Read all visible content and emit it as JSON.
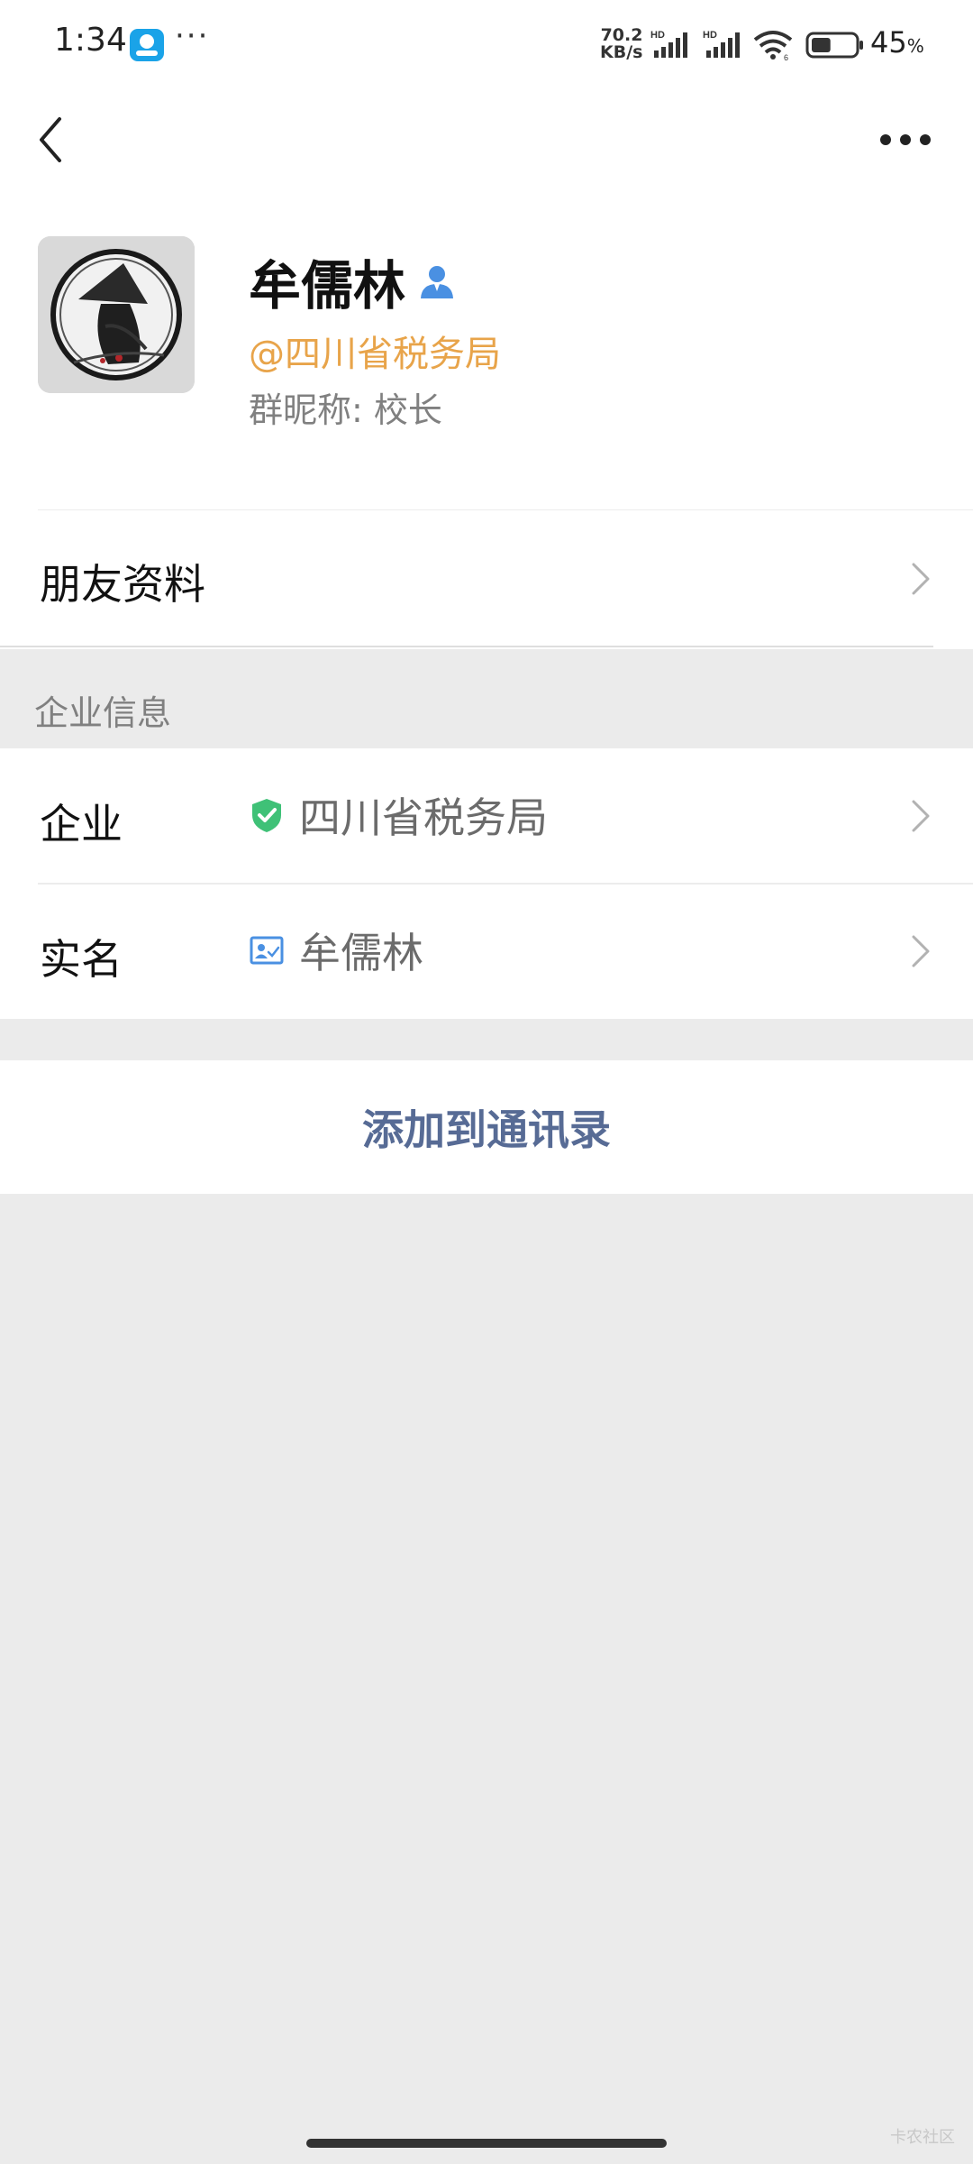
{
  "status_bar": {
    "time": "1:34",
    "more": "···",
    "speed_value": "70.2",
    "speed_unit": "KB/s",
    "signal_label": "HD",
    "battery_level": 0.45,
    "battery_percent": "45",
    "battery_unit": "%"
  },
  "header": {
    "back_icon": "chevron-left-icon",
    "more_icon": "ellipsis-icon"
  },
  "profile": {
    "name": "牟儒林",
    "org_tag": "@四川省税务局",
    "nickname_label": "群昵称:",
    "nickname_value": "校长"
  },
  "friend_info": {
    "label": "朋友资料"
  },
  "enterprise_section": {
    "title": "企业信息",
    "rows": [
      {
        "label": "企业",
        "value": "四川省税务局",
        "icon": "verified-shield-icon"
      },
      {
        "label": "实名",
        "value": "牟儒林",
        "icon": "id-card-icon"
      }
    ]
  },
  "actions": {
    "add_contact": "添加到通讯录"
  },
  "watermark": "卡农社区",
  "colors": {
    "accent_orange": "#e8a44a",
    "link_blue": "#576b95",
    "verified_green": "#3fc177",
    "badge_blue": "#4a90e2",
    "background": "#ebebeb"
  }
}
